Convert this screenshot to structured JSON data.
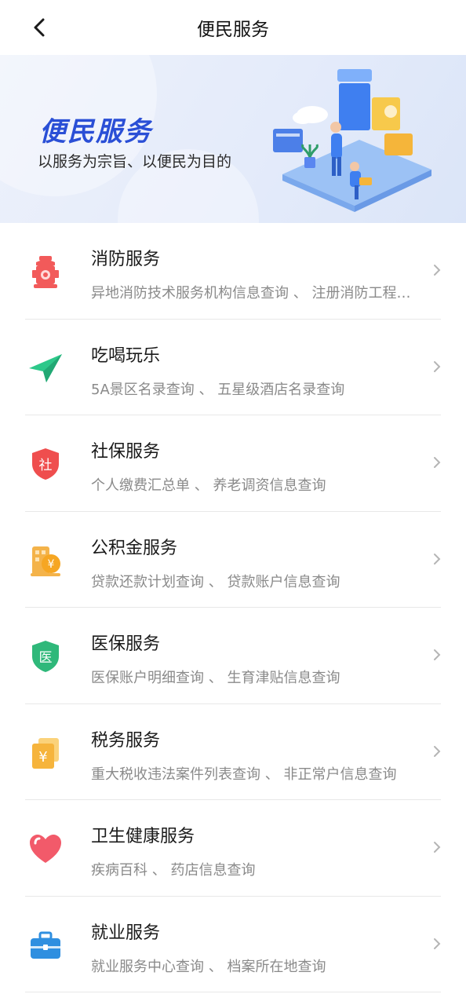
{
  "header": {
    "title": "便民服务",
    "back_icon": "chevron-left-icon"
  },
  "banner": {
    "heading": "便民服务",
    "subtitle": "以服务为宗旨、以便民为目的",
    "colors": {
      "heading": "#2a4fd6",
      "background": "#e6ecfa"
    }
  },
  "services": [
    {
      "title": "消防服务",
      "desc": "异地消防技术服务机构信息查询 、 注册消防工程师信息查询",
      "icon": "fire-hydrant-icon",
      "color": "#f25a5a"
    },
    {
      "title": "吃喝玩乐",
      "desc": "5A景区名录查询 、 五星级酒店名录查询",
      "icon": "paper-plane-icon",
      "color": "#2dc88a"
    },
    {
      "title": "社保服务",
      "desc": "个人缴费汇总单 、 养老调资信息查询",
      "icon": "shield-social-icon",
      "color": "#ef4e4e",
      "glyph": "社"
    },
    {
      "title": "公积金服务",
      "desc": "贷款还款计划查询 、 贷款账户信息查询",
      "icon": "building-coin-icon",
      "color": "#f4b34a"
    },
    {
      "title": "医保服务",
      "desc": "医保账户明细查询 、 生育津贴信息查询",
      "icon": "shield-medical-icon",
      "color": "#2fb87a",
      "glyph": "医"
    },
    {
      "title": "税务服务",
      "desc": "重大税收违法案件列表查询 、 非正常户信息查询",
      "icon": "tax-yuan-icon",
      "color": "#f6b43c"
    },
    {
      "title": "卫生健康服务",
      "desc": "疾病百科 、 药店信息查询",
      "icon": "heart-icon",
      "color": "#f25a6a"
    },
    {
      "title": "就业服务",
      "desc": "就业服务中心查询 、 档案所在地查询",
      "icon": "briefcase-icon",
      "color": "#2f8fe0"
    }
  ]
}
